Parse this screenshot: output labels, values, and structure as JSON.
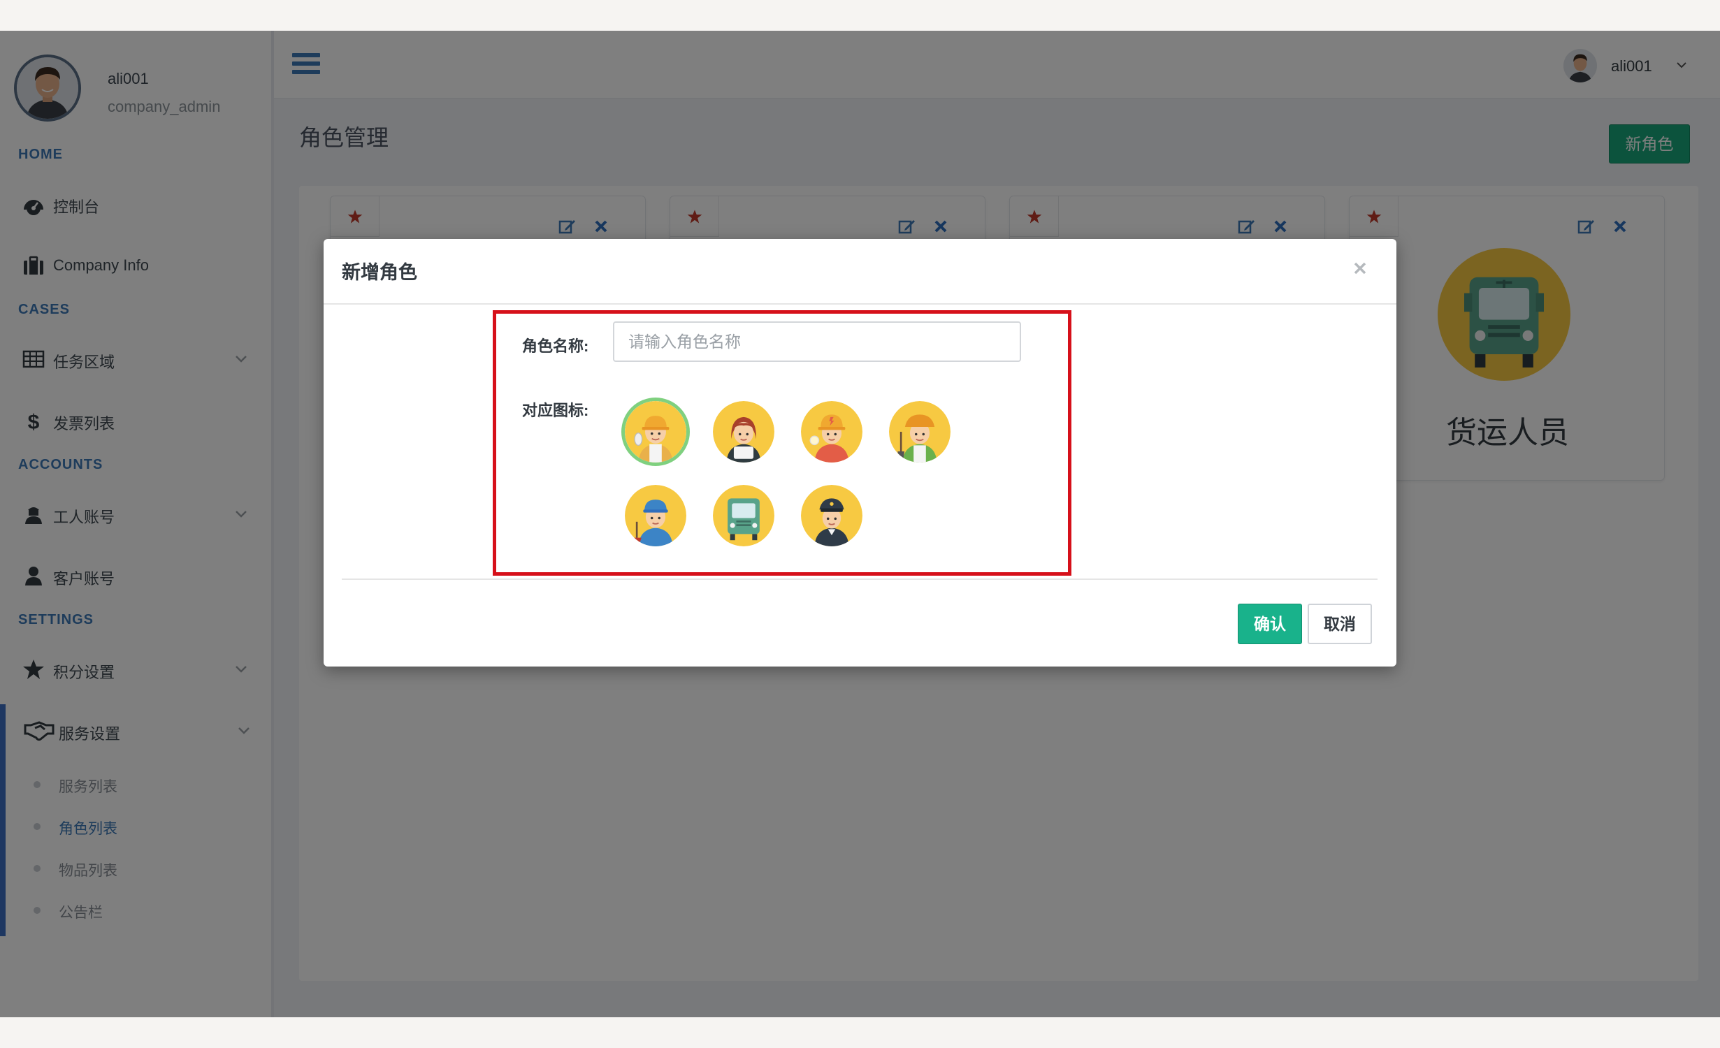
{
  "sidebar": {
    "profile": {
      "name": "ali001",
      "role": "company_admin"
    },
    "sections": {
      "home": "HOME",
      "cases": "CASES",
      "accounts": "ACCOUNTS",
      "settings": "SETTINGS"
    },
    "items": [
      {
        "label": "控制台",
        "icon": "dashboard-icon"
      },
      {
        "label": "Company Info",
        "icon": "briefcase-icon"
      },
      {
        "label": "任务区域",
        "icon": "table-icon"
      },
      {
        "label": "发票列表",
        "icon": "dollar-icon"
      },
      {
        "label": "工人账号",
        "icon": "worker-icon"
      },
      {
        "label": "客户账号",
        "icon": "user-icon"
      },
      {
        "label": "积分设置",
        "icon": "star-icon"
      },
      {
        "label": "服务设置",
        "icon": "handshake-icon"
      }
    ],
    "sub_items": [
      {
        "label": "服务列表",
        "active": false
      },
      {
        "label": "角色列表",
        "active": true
      },
      {
        "label": "物品列表",
        "active": false
      },
      {
        "label": "公告栏",
        "active": false
      }
    ]
  },
  "topbar": {
    "user_name": "ali001"
  },
  "page": {
    "title": "角色管理",
    "new_button": "新角色"
  },
  "cards": [
    {
      "name": ""
    },
    {
      "name": ""
    },
    {
      "name": ""
    },
    {
      "name": "货运人员"
    }
  ],
  "modal": {
    "title": "新增角色",
    "name_label": "角色名称:",
    "name_placeholder": "请输入角色名称",
    "name_value": "",
    "icon_label": "对应图标:",
    "icons": [
      "worker-icon",
      "housekeeper-icon",
      "electrician-icon",
      "gardener-icon",
      "plumber-icon",
      "truck-icon",
      "security-guard-icon"
    ],
    "selected_icon": "worker-icon",
    "confirm": "确认",
    "cancel": "取消"
  },
  "colors": {
    "accent_blue": "#3c78b7",
    "primary_green": "#19a77a",
    "highlight_red": "#d6101a",
    "icon_yellow": "#f7c942"
  }
}
